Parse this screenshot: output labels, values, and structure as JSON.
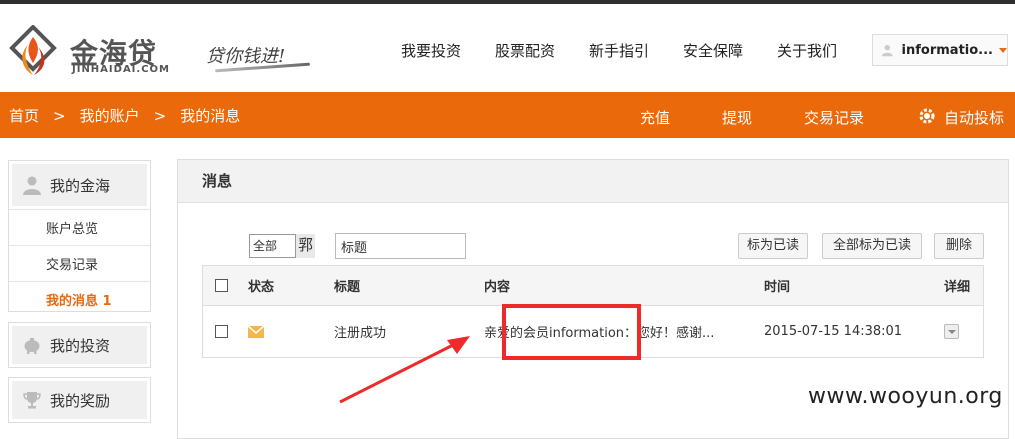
{
  "brand": {
    "name_cn": "金海贷",
    "name_en": "JINHAIDAI.COM",
    "slogan": "贷你钱进!",
    "accent": "#ea6a0b"
  },
  "nav": [
    "我要投资",
    "股票配资",
    "新手指引",
    "安全保障",
    "关于我们"
  ],
  "user": {
    "name": "informatio...",
    "icon": "user-icon"
  },
  "breadcrumb": [
    "首页",
    ">",
    "我的账户",
    ">",
    "我的消息"
  ],
  "bar_links": [
    "充值",
    "提现",
    "交易记录",
    "自动投标"
  ],
  "sidebar": {
    "sections": [
      {
        "label": "我的金海",
        "icon": "user-icon",
        "items": [
          "账户总览",
          "交易记录",
          "我的消息 1"
        ],
        "active": "我的消息 1"
      },
      {
        "label": "我的投资",
        "icon": "piggy-bank-icon"
      },
      {
        "label": "我的奖励",
        "icon": "trophy-icon"
      }
    ]
  },
  "panel": {
    "title": "消息",
    "filter_value": "全部",
    "filter_tail": "郛",
    "title_input_value": "标题",
    "buttons": {
      "mark_read": "标为已读",
      "mark_all_read": "全部标为已读",
      "delete": "删除"
    },
    "columns": [
      "状态",
      "标题",
      "内容",
      "时间",
      "详细"
    ],
    "rows": [
      {
        "status_icon": "envelope-icon",
        "title": "注册成功",
        "content": "亲爱的会员information：您好！感谢...",
        "time": "2015-07-15 14:38:01"
      }
    ]
  },
  "watermark": "www.wooyun.org"
}
